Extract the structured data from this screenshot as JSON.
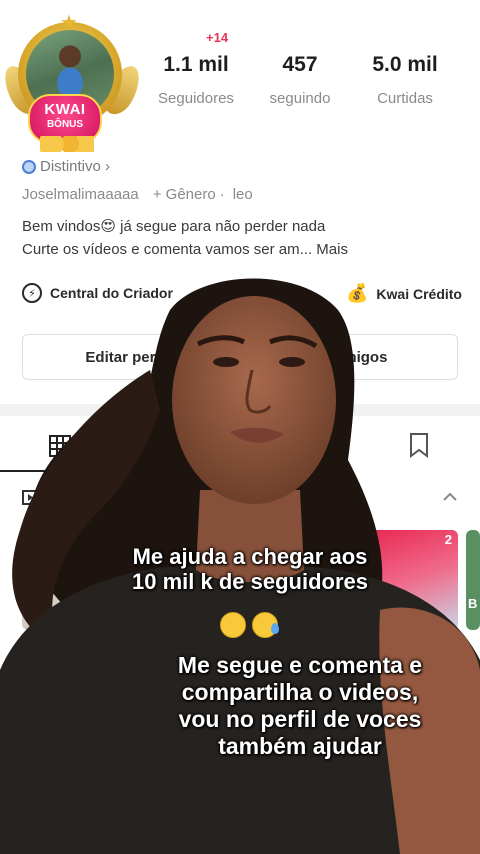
{
  "profile": {
    "avatar": {
      "badge_title": "KWAI",
      "badge_subtitle": "BÔNUS"
    },
    "notification_badge": "+14",
    "stats": [
      {
        "value": "1.1 mil",
        "label": "Seguidores"
      },
      {
        "value": "457",
        "label": "seguindo"
      },
      {
        "value": "5.0 mil",
        "label": "Curtidas"
      }
    ],
    "distintivo_label": "Distintivo ›",
    "username": "Joselmalimaaaaa",
    "gender_label": "+ Gênero",
    "sign": "leo",
    "bio_line1": "Bem vindos😍 já segue para não perder nada",
    "bio_line2": "Curte os vídeos e comenta vamos ser am... Mais",
    "creator_center": "Central do Criador",
    "kwai_credits": "Kwai Crédito",
    "edit_button": "Editar perfi",
    "share_button": "ar amigos"
  },
  "thumbnails": [
    {
      "count": ""
    },
    {
      "count": "2"
    },
    {
      "count": "B"
    }
  ],
  "captions": {
    "line1": "Me ajuda a chegar aos",
    "line2": "10 mil k de seguidores",
    "line3": "Me segue e comenta e",
    "line4": "compartilha o videos,",
    "line5": "vou no perfil de voces",
    "line6": "também ajudar"
  },
  "icons": [
    "distintivo-icon",
    "creator-center-icon",
    "kwai-credits-icon",
    "grid-icon",
    "bookmark-icon",
    "playlist-icon",
    "chevron-up-icon"
  ],
  "colors": {
    "accent_pink": "#e8345a",
    "text_gray": "#8a8a8a",
    "badge_gold": "#d9a92c"
  }
}
